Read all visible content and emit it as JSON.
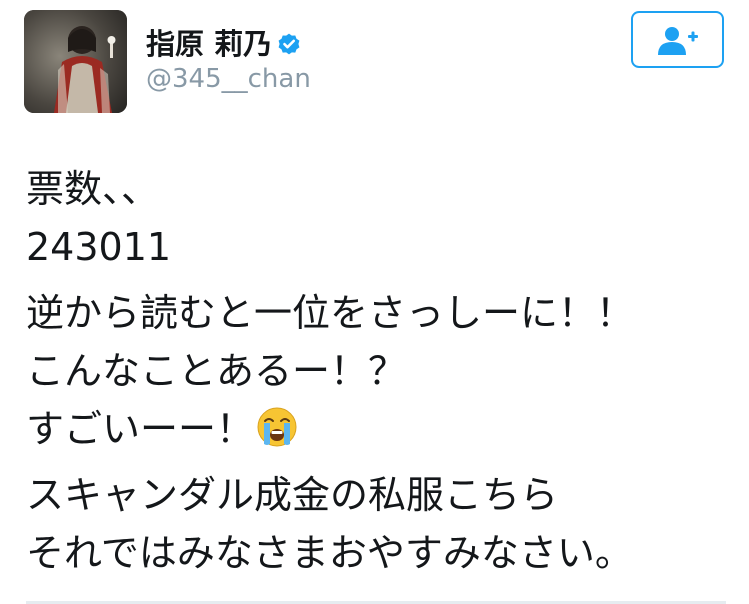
{
  "header": {
    "display_name": "指原 莉乃",
    "handle": "@345__chan",
    "verified": true,
    "avatar_icon": "profile-photo",
    "follow_icon": "add-user-icon"
  },
  "tweet": {
    "lines": [
      "票数、、",
      "243011",
      "逆から読むと一位をさっしーに！！",
      "こんなことあるー！？",
      "すごいーー！",
      "スキャンダル成金の私服こちら",
      "それではみなさまおやすみなさい。"
    ],
    "emoji": "loudly-crying-face-emoji"
  },
  "colors": {
    "accent": "#1da1f2",
    "text": "#14171a",
    "secondary_text": "#8899a6",
    "divider": "#e6ecf0"
  }
}
